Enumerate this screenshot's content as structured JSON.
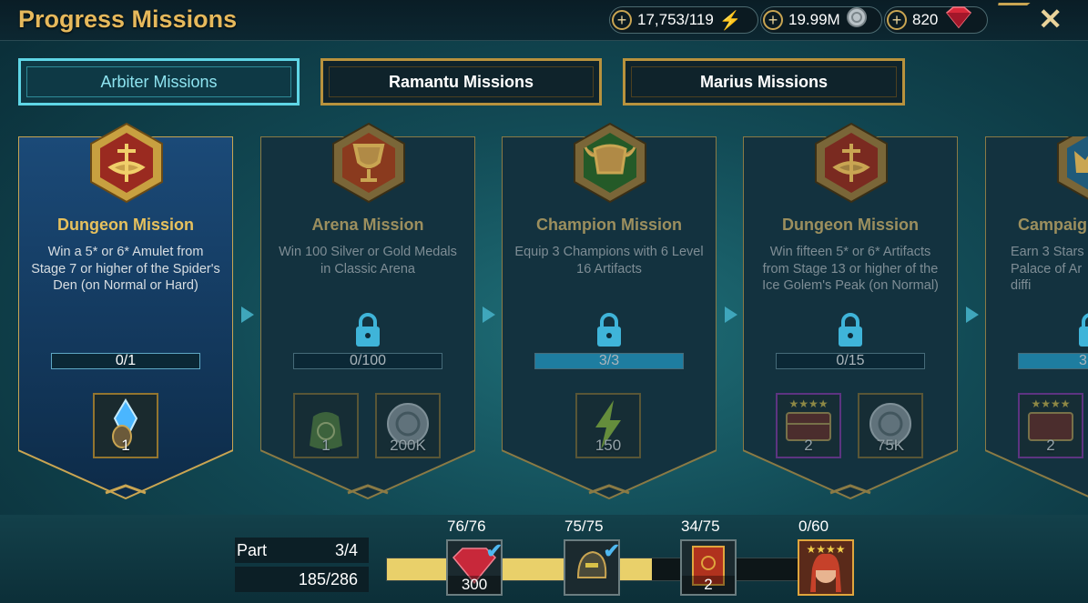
{
  "header": {
    "title": "Progress Missions",
    "close_icon": "close-icon"
  },
  "resources": [
    {
      "value": "17,753/119",
      "icon": "energy-icon"
    },
    {
      "value": "19.99M",
      "icon": "silver-icon"
    },
    {
      "value": "820",
      "icon": "gem-icon"
    }
  ],
  "tabs": [
    {
      "label": "Arbiter Missions",
      "active": true
    },
    {
      "label": "Ramantu Missions",
      "active": false
    },
    {
      "label": "Marius Missions",
      "active": false
    }
  ],
  "missions": [
    {
      "title": "Dungeon Mission",
      "description": "Win a 5* or 6* Amulet from Stage 7 or higher of the Spider's Den (on Normal or Hard)",
      "progress": "0/1",
      "progress_fraction": 0,
      "locked": false,
      "rewards": [
        {
          "icon": "amulet-icon",
          "count": "1"
        }
      ]
    },
    {
      "title": "Arena Mission",
      "description": "Win 100 Silver or Gold Medals in Classic Arena",
      "progress": "0/100",
      "progress_fraction": 0,
      "locked": true,
      "rewards": [
        {
          "icon": "xp-potion-bag-icon",
          "count": "1"
        },
        {
          "icon": "silver-coin-icon",
          "count": "200K"
        }
      ]
    },
    {
      "title": "Champion Mission",
      "description": "Equip 3 Champions with 6 Level 16 Artifacts",
      "progress": "3/3",
      "progress_fraction": 1,
      "locked": true,
      "rewards": [
        {
          "icon": "energy-icon",
          "count": "150"
        }
      ]
    },
    {
      "title": "Dungeon Mission",
      "description": "Win fifteen 5* or 6* Artifacts from Stage 13 or higher of the Ice Golem's Peak (on Normal)",
      "progress": "0/15",
      "progress_fraction": 0,
      "locked": true,
      "rewards": [
        {
          "icon": "artifact-chest-icon",
          "count": "2"
        },
        {
          "icon": "silver-coin-icon",
          "count": "75K"
        }
      ]
    },
    {
      "title": "Campaig",
      "description": "Earn 3 Stars Palace of Ar diffi",
      "progress": "3",
      "progress_fraction": 1,
      "locked": true,
      "rewards": [
        {
          "icon": "artifact-chest-icon",
          "count": "2"
        }
      ]
    }
  ],
  "part": {
    "label": "Part",
    "value": "3/4",
    "points": "185/286",
    "track_fraction": 0.62
  },
  "milestones": [
    {
      "label": "76/76",
      "icon": "ruby-icon",
      "count": "300",
      "done": true
    },
    {
      "label": "75/75",
      "icon": "helmet-icon",
      "count": "",
      "done": true
    },
    {
      "label": "34/75",
      "icon": "tome-icon",
      "count": "2",
      "done": false
    },
    {
      "label": "0/60",
      "icon": "champion-portrait-icon",
      "count": "",
      "done": false
    }
  ]
}
